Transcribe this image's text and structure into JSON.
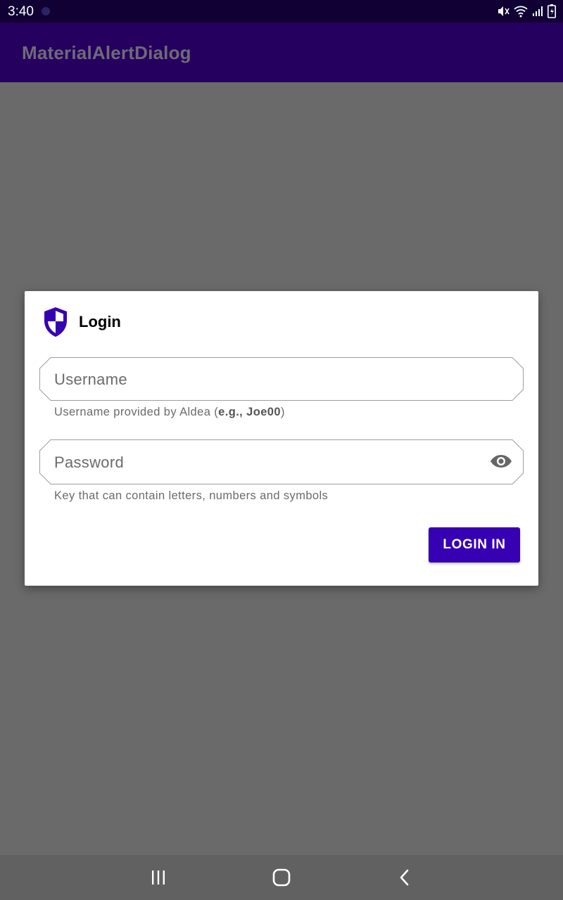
{
  "status_bar": {
    "time": "3:40",
    "icons": [
      "mute-icon",
      "wifi-icon",
      "signal-icon",
      "battery-icon"
    ]
  },
  "app_bar": {
    "title": "MaterialAlertDialog"
  },
  "dialog": {
    "icon": "shield-icon",
    "title": "Login",
    "username": {
      "placeholder": "Username",
      "value": "",
      "helper_prefix": "Username provided by Aldea (",
      "helper_example": "e.g., Joe00",
      "helper_suffix": ")"
    },
    "password": {
      "placeholder": "Password",
      "value": "",
      "toggle_icon": "eye-icon",
      "helper": "Key that can contain letters, numbers and symbols"
    },
    "login_button_label": "LOGIN IN"
  },
  "nav_bar": {
    "buttons": [
      "recents-icon",
      "home-icon",
      "back-icon"
    ]
  },
  "colors": {
    "status_bar": "#100034",
    "app_bar": "#25005e",
    "scrim": "#6a6a6a",
    "accent": "#3700b3",
    "nav_bar": "#616161"
  }
}
